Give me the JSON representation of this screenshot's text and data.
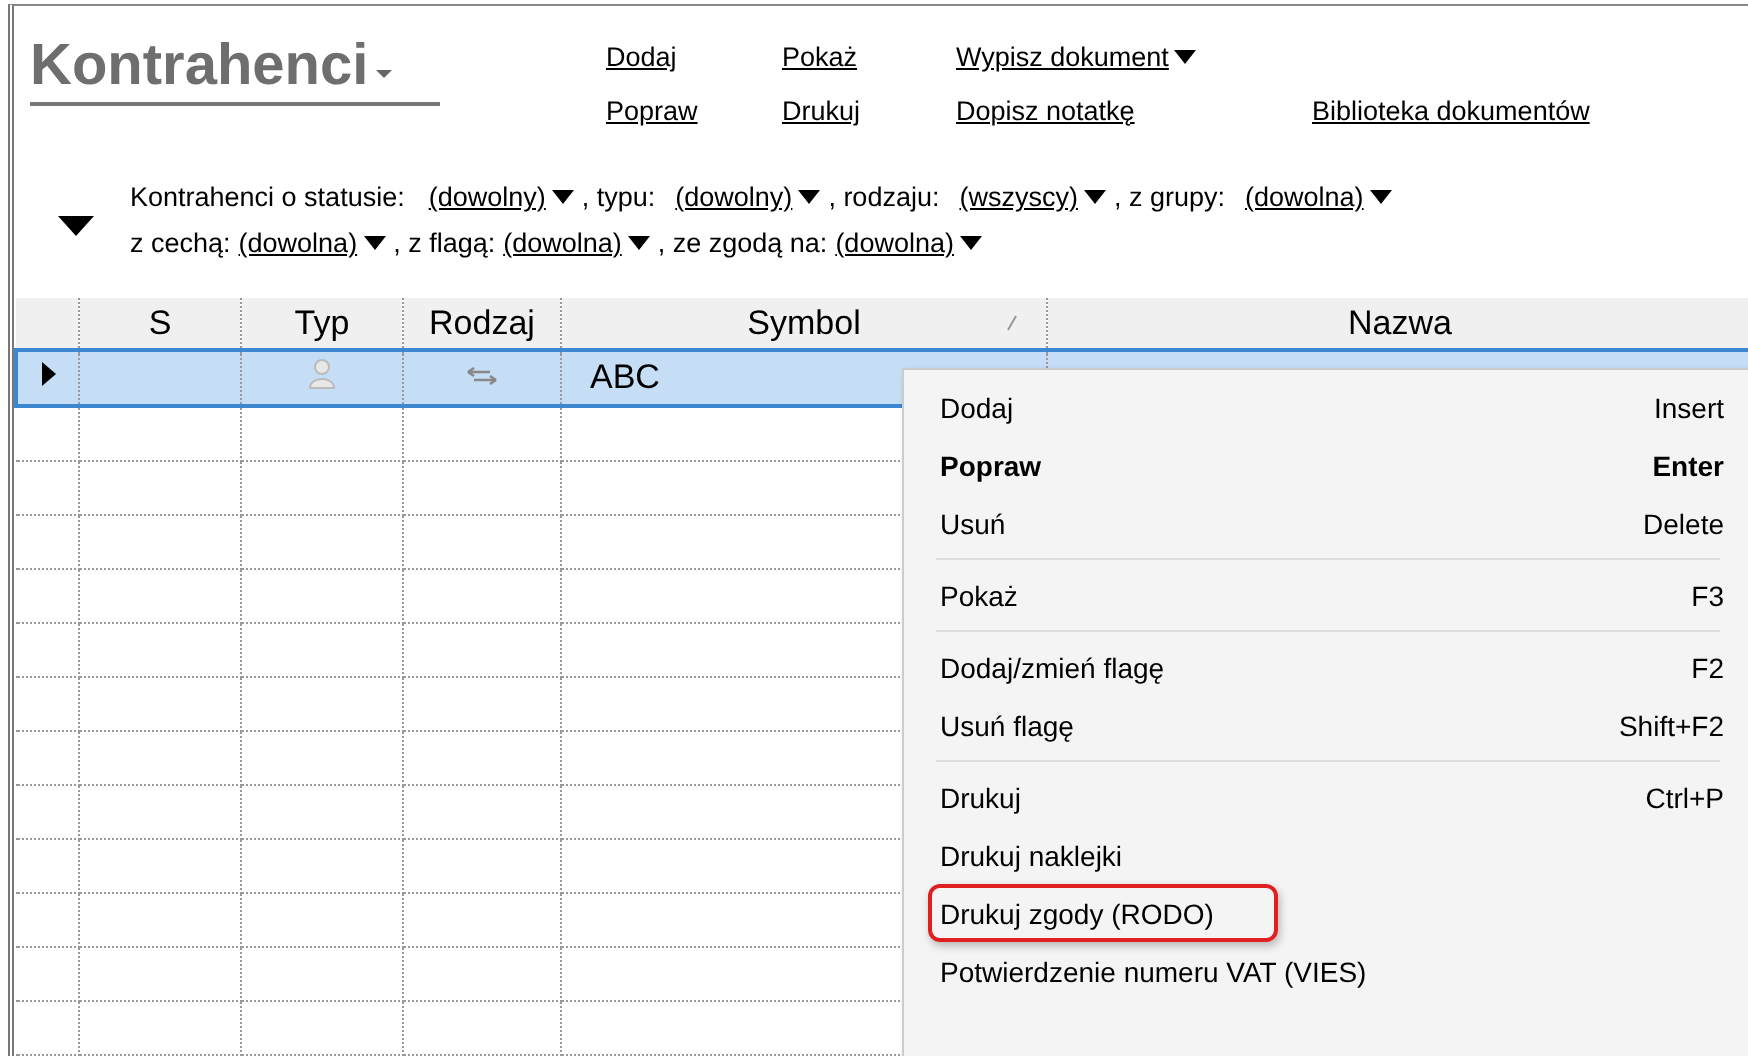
{
  "title": "Kontrahenci",
  "action_columns": [
    [
      {
        "label": "Dodaj",
        "dropdown": false
      },
      {
        "label": "Popraw",
        "dropdown": false
      }
    ],
    [
      {
        "label": "Pokaż",
        "dropdown": false
      },
      {
        "label": "Drukuj",
        "dropdown": false
      }
    ],
    [
      {
        "label": "Wypisz dokument",
        "dropdown": true
      },
      {
        "label": "Dopisz notatkę",
        "dropdown": false
      }
    ],
    [
      {
        "label": "Biblioteka dokumentów",
        "dropdown": false
      }
    ]
  ],
  "filter_lines": [
    [
      {
        "label": "Kontrahenci o statusie:",
        "value": "(dowolny)"
      },
      {
        "label": ", typu:",
        "value": "(dowolny)"
      },
      {
        "label": ", rodzaju:",
        "value": "(wszyscy)"
      },
      {
        "label": ", z grupy:",
        "value": "(dowolna)"
      }
    ],
    [
      {
        "label": "z cechą:",
        "value": "(dowolna)"
      },
      {
        "label": ", z flagą:",
        "value": "(dowolna)"
      },
      {
        "label": ", ze zgodą na:",
        "value": "(dowolna)"
      }
    ]
  ],
  "table": {
    "columns": [
      {
        "label": "S",
        "sorted": false
      },
      {
        "label": "Typ",
        "sorted": false
      },
      {
        "label": "Rodzaj",
        "sorted": false
      },
      {
        "label": "Symbol",
        "sorted": true
      },
      {
        "label": "Nazwa",
        "sorted": false
      }
    ],
    "rows": [
      {
        "selected": true,
        "symbol": "ABC"
      }
    ]
  },
  "context_menu": [
    [
      {
        "label": "Dodaj",
        "shortcut": "Insert",
        "default": false,
        "highlighted": false
      },
      {
        "label": "Popraw",
        "shortcut": "Enter",
        "default": true,
        "highlighted": false
      },
      {
        "label": "Usuń",
        "shortcut": "Delete",
        "default": false,
        "highlighted": false
      }
    ],
    [
      {
        "label": "Pokaż",
        "shortcut": "F3",
        "default": false,
        "highlighted": false
      }
    ],
    [
      {
        "label": "Dodaj/zmień flagę",
        "shortcut": "F2",
        "default": false,
        "highlighted": false
      },
      {
        "label": "Usuń flagę",
        "shortcut": "Shift+F2",
        "default": false,
        "highlighted": false
      }
    ],
    [
      {
        "label": "Drukuj",
        "shortcut": "Ctrl+P",
        "default": false,
        "highlighted": false
      },
      {
        "label": "Drukuj naklejki",
        "default": false,
        "highlighted": false
      },
      {
        "label": "Drukuj zgody (RODO)",
        "default": false,
        "highlighted": true
      },
      {
        "label": "Potwierdzenie numeru VAT (VIES)",
        "default": false,
        "highlighted": false
      }
    ]
  ]
}
